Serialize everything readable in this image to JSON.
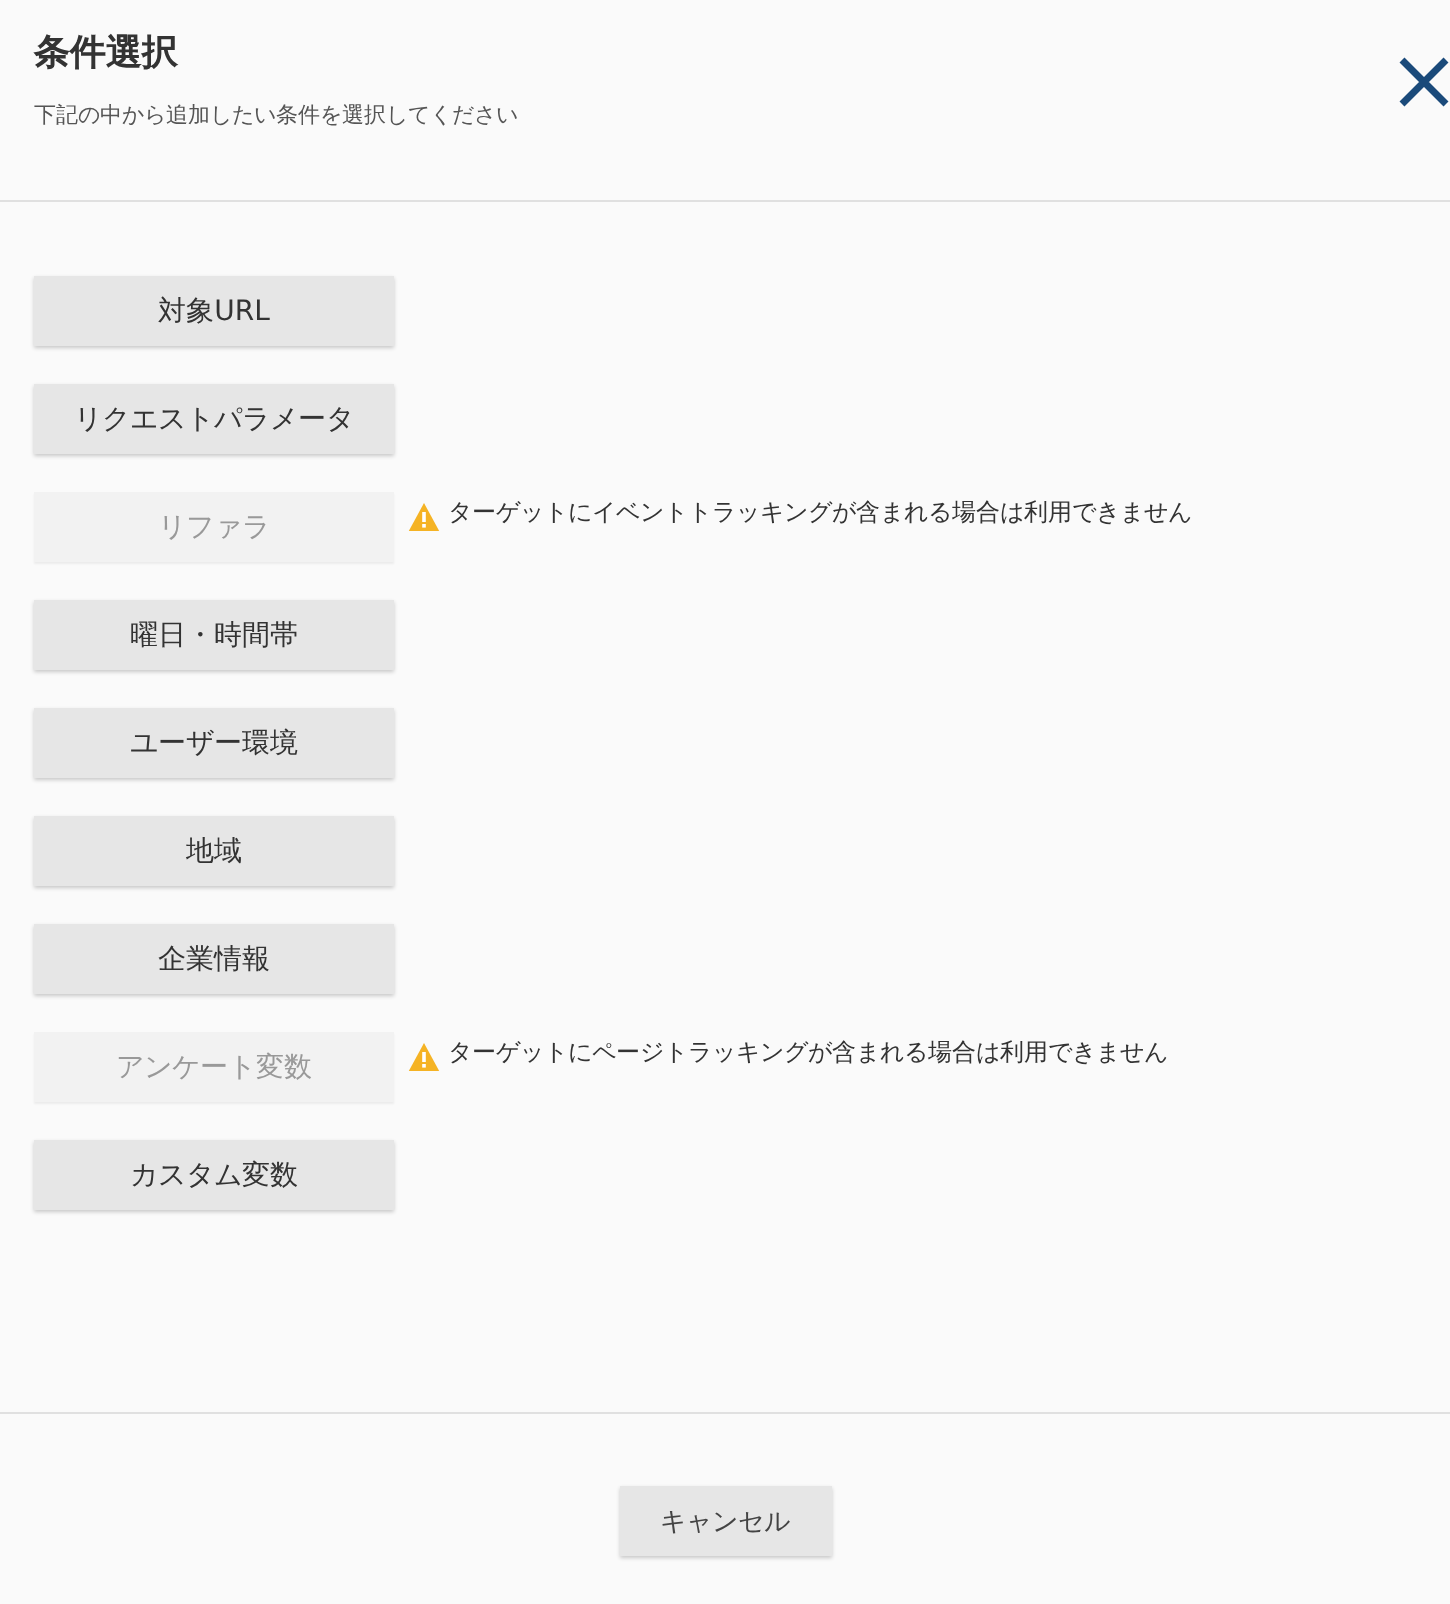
{
  "dialog": {
    "title": "条件選択",
    "subtitle": "下記の中から追加したい条件を選択してください"
  },
  "conditions": [
    {
      "label": "対象URL",
      "disabled": false
    },
    {
      "label": "リクエストパラメータ",
      "disabled": false
    },
    {
      "label": "リファラ",
      "disabled": true,
      "warning": "ターゲットにイベントトラッキングが含まれる場合は利用できません"
    },
    {
      "label": "曜日・時間帯",
      "disabled": false
    },
    {
      "label": "ユーザー環境",
      "disabled": false
    },
    {
      "label": "地域",
      "disabled": false
    },
    {
      "label": "企業情報",
      "disabled": false
    },
    {
      "label": "アンケート変数",
      "disabled": true,
      "warning": "ターゲットにページトラッキングが含まれる場合は利用できません"
    },
    {
      "label": "カスタム変数",
      "disabled": false
    }
  ],
  "footer": {
    "cancel": "キャンセル"
  }
}
